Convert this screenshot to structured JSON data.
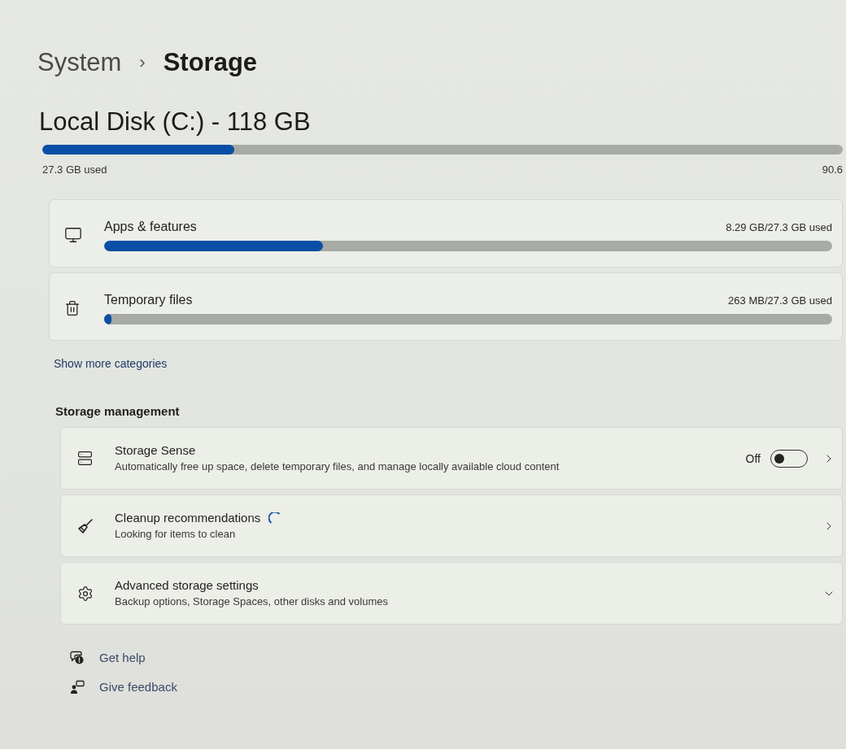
{
  "breadcrumb": {
    "items": [
      {
        "label": "System",
        "current": false
      },
      {
        "label": "Storage",
        "current": true
      }
    ],
    "separator": "›"
  },
  "disk": {
    "title": "Local Disk (C:) - 118 GB",
    "level": 0.24,
    "used_label": "27.3 GB used",
    "right_label": "90.6"
  },
  "categories": [
    {
      "kind": "apps",
      "name": "Apps & features",
      "usage": "8.29 GB/27.3 GB used",
      "level": 0.3
    },
    {
      "kind": "temp",
      "name": "Temporary files",
      "usage": "263 MB/27.3 GB used",
      "level": 0.01
    }
  ],
  "show_more": "Show more categories",
  "management": {
    "heading": "Storage management",
    "items": [
      {
        "kind": "sense",
        "title": "Storage Sense",
        "description": "Automatically free up space, delete temporary files, and manage locally available cloud content",
        "toggle": {
          "label": "Off",
          "on": false
        },
        "loading": false,
        "expandable": false
      },
      {
        "kind": "cleanup",
        "title": "Cleanup recommendations",
        "description": "Looking for items to clean",
        "loading": true,
        "expandable": false
      },
      {
        "kind": "advanced",
        "title": "Advanced storage settings",
        "description": "Backup options, Storage Spaces, other disks and volumes",
        "loading": false,
        "expandable": true
      }
    ]
  },
  "help_links": [
    {
      "kind": "help",
      "label": "Get help"
    },
    {
      "kind": "feedback",
      "label": "Give feedback"
    }
  ]
}
